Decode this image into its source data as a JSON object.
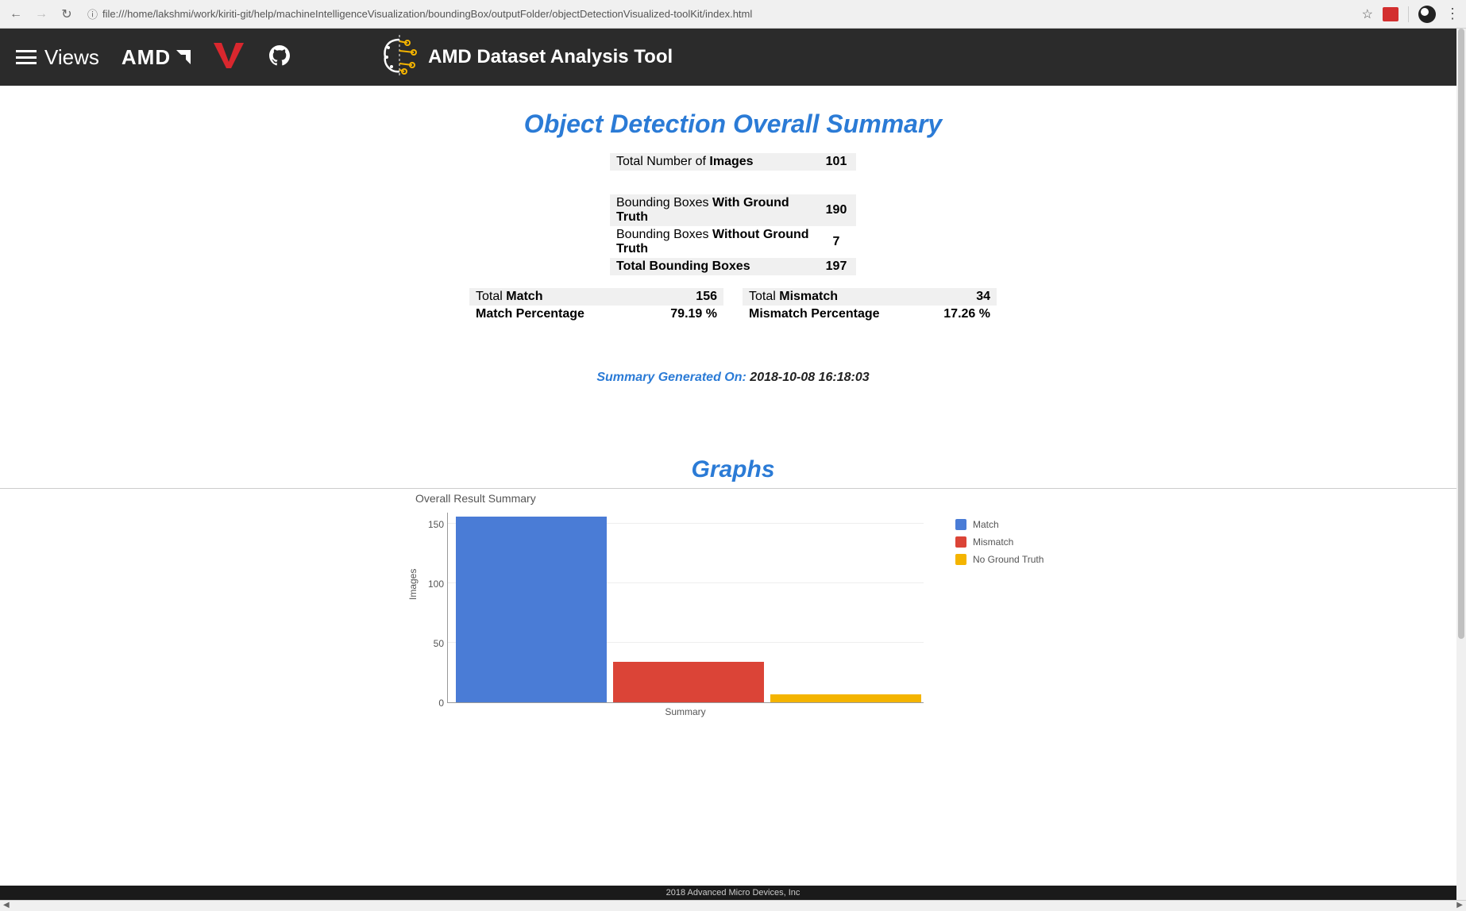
{
  "browser": {
    "url": "file:///home/lakshmi/work/kiriti-git/help/machineIntelligenceVisualization/boundingBox/outputFolder/objectDetectionVisualized-toolKit/index.html"
  },
  "header": {
    "views_label": "Views",
    "amd_text": "AMD",
    "app_title": "AMD Dataset Analysis Tool"
  },
  "summary": {
    "title": "Object Detection Overall Summary",
    "images_label_prefix": "Total Number of ",
    "images_label_bold": "Images",
    "images_value": "101",
    "bbgt_prefix": "Bounding Boxes ",
    "bbgt_bold": "With Ground Truth",
    "bbgt_value": "190",
    "bbngt_prefix": "Bounding Boxes ",
    "bbngt_bold": "Without Ground Truth",
    "bbngt_value": "7",
    "tbb_label": "Total Bounding Boxes",
    "tbb_value": "197",
    "match_prefix": "Total ",
    "match_bold": "Match",
    "match_value": "156",
    "matchpct_label": "Match Percentage",
    "matchpct_value": "79.19 %",
    "mismatch_prefix": "Total ",
    "mismatch_bold": "Mismatch",
    "mismatch_value": "34",
    "mismatchpct_label": "Mismatch Percentage",
    "mismatchpct_value": "17.26 %",
    "gen_label": "Summary Generated On: ",
    "gen_value": "2018-10-08 16:18:03"
  },
  "graphs": {
    "title": "Graphs",
    "chart_title": "Overall Result Summary",
    "ylabel": "Images",
    "xlabel": "Summary",
    "legend": [
      "Match",
      "Mismatch",
      "No Ground Truth"
    ],
    "y_ticks": [
      "0",
      "50",
      "100",
      "150"
    ],
    "colors": {
      "match": "#4a7cd6",
      "mismatch": "#db4437",
      "noground": "#f4b400"
    }
  },
  "chart_data": {
    "type": "bar",
    "categories": [
      "Summary"
    ],
    "series": [
      {
        "name": "Match",
        "values": [
          156
        ],
        "color": "#4a7cd6"
      },
      {
        "name": "Mismatch",
        "values": [
          34
        ],
        "color": "#db4437"
      },
      {
        "name": "No Ground Truth",
        "values": [
          7
        ],
        "color": "#f4b400"
      }
    ],
    "title": "Overall Result Summary",
    "xlabel": "Summary",
    "ylabel": "Images",
    "ylim": [
      0,
      160
    ]
  },
  "footer": {
    "text": "2018 Advanced Micro Devices, Inc"
  }
}
